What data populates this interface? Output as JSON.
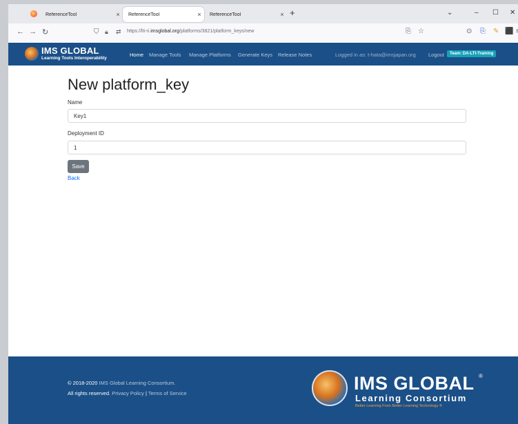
{
  "browser": {
    "tabs": [
      {
        "label": "ReferenceTool"
      },
      {
        "label": "ReferenceTool"
      },
      {
        "label": "ReferenceTool"
      }
    ],
    "new_tab_label": "+",
    "close_glyph": "×",
    "url_prefix": "https://lti-ri.",
    "url_domain": "imsglobal.org",
    "url_path": "/platforms/3821/platform_keys/new"
  },
  "header": {
    "logo_title": "IMS GLOBAL",
    "logo_subtitle": "Learning Tools Interoperability",
    "nav": [
      "Home",
      "Manage Tools",
      "Manage Platforms",
      "Generate Keys",
      "Release Notes"
    ],
    "logged_in": "Logged in as: t-hata@imsjapan.org",
    "logout": "Logout",
    "team_badge": "Team: DA-LTI-Training",
    "colors": {
      "header_bg": "#1b4f87",
      "badge_bg": "#17a2b8"
    }
  },
  "main": {
    "title": "New platform_key",
    "name_label": "Name",
    "name_value": "Key1",
    "deployment_label": "Deployment ID",
    "deployment_value": "1",
    "save_label": "Save",
    "back_label": "Back"
  },
  "footer": {
    "copyright_line1_prefix": "© 2018-2020 ",
    "copyright_org": "IMS Global Learning Consortium.",
    "copyright_line2_prefix": "All rights reserved. ",
    "privacy": "Privacy Policy",
    "separator": " | ",
    "terms": "Terms of Service",
    "logo_title": "IMS GLOBAL",
    "logo_reg": "®",
    "logo_subtitle": "Learning Consortium",
    "logo_tagline": "Better Learning From Better Learning Technology ®"
  }
}
